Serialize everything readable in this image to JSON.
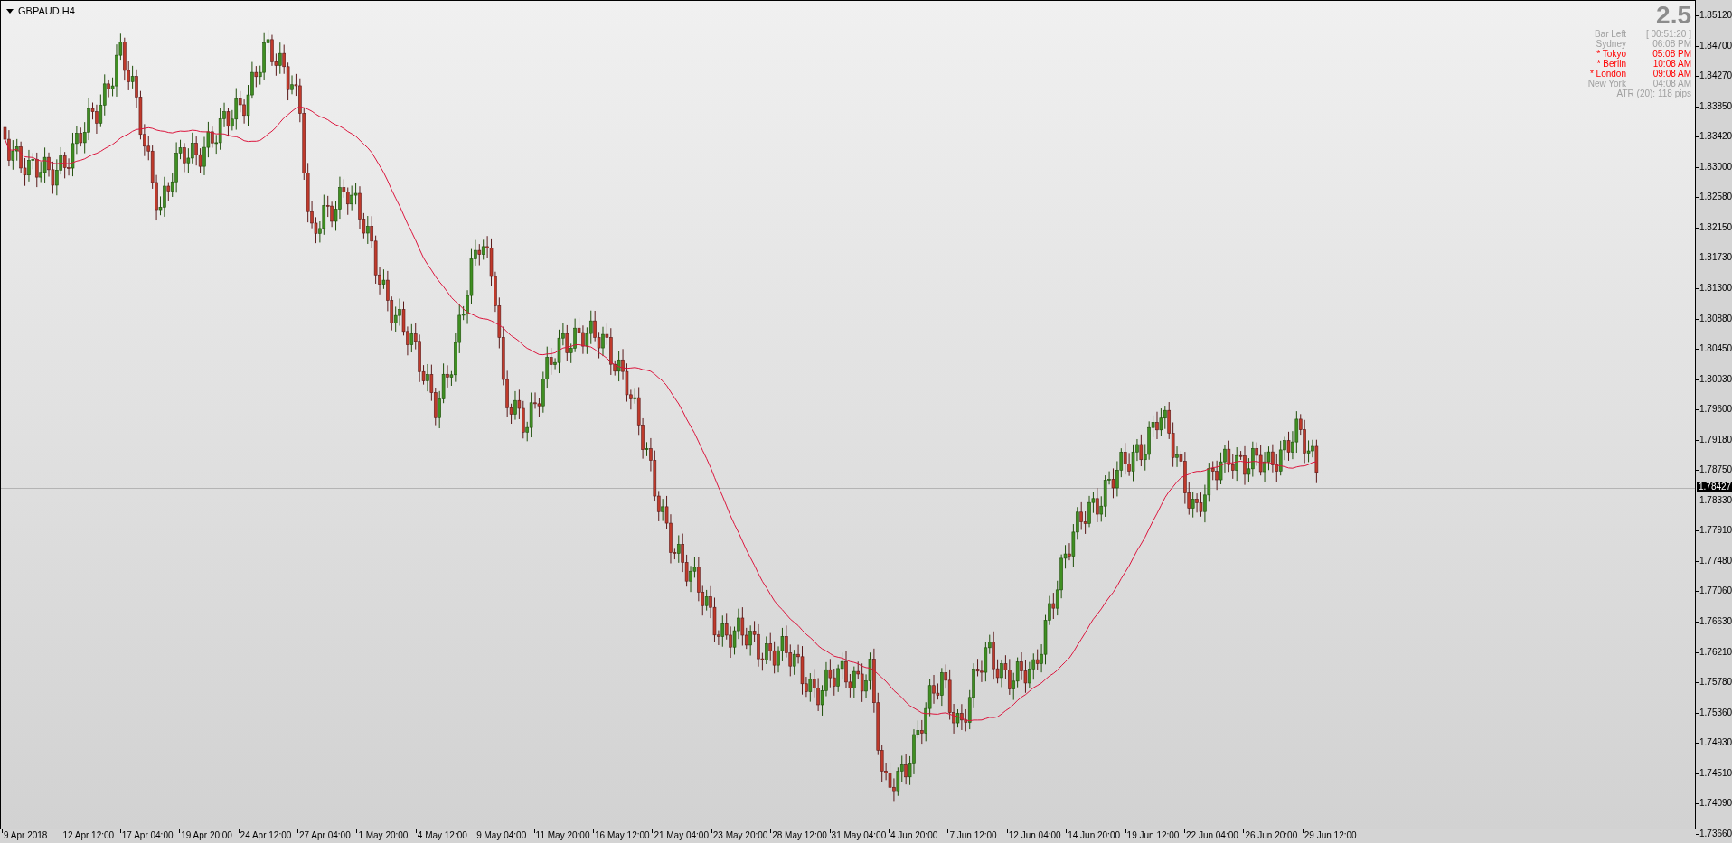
{
  "chart": {
    "title": "GBPAUD,H4",
    "spread": "2.5",
    "info_rows": [
      {
        "label": "Bar Left",
        "value": "[ 00:51:20 ]",
        "active": false
      },
      {
        "label": "Sydney",
        "value": "06:08 PM",
        "active": false
      },
      {
        "label": "* Tokyo",
        "value": "05:08 PM",
        "active": true
      },
      {
        "label": "* Berlin",
        "value": "10:08 AM",
        "active": true
      },
      {
        "label": "* London",
        "value": "09:08 AM",
        "active": true
      },
      {
        "label": "New York",
        "value": "04:08 AM",
        "active": false
      }
    ],
    "atr": "ATR (20): 118 pips",
    "price_ticks": [
      "1.85120",
      "1.84700",
      "1.84270",
      "1.83850",
      "1.83420",
      "1.83000",
      "1.82580",
      "1.82150",
      "1.81730",
      "1.81300",
      "1.80880",
      "1.80450",
      "1.80030",
      "1.79600",
      "1.79180",
      "1.78750",
      "1.78330",
      "1.77910",
      "1.77480",
      "1.77060",
      "1.76630",
      "1.76210",
      "1.75780",
      "1.75360",
      "1.74930",
      "1.74510",
      "1.74090",
      "1.73660"
    ],
    "current_price": "1.78427",
    "time_ticks": [
      "9 Apr 2018",
      "12 Apr 12:00",
      "17 Apr 04:00",
      "19 Apr 20:00",
      "24 Apr 12:00",
      "27 Apr 04:00",
      "1 May 20:00",
      "4 May 12:00",
      "9 May 04:00",
      "11 May 20:00",
      "16 May 12:00",
      "21 May 04:00",
      "23 May 20:00",
      "28 May 12:00",
      "31 May 04:00",
      "4 Jun 20:00",
      "7 Jun 12:00",
      "12 Jun 04:00",
      "14 Jun 20:00",
      "19 Jun 12:00",
      "22 Jun 04:00",
      "26 Jun 20:00",
      "29 Jun 12:00"
    ]
  }
}
